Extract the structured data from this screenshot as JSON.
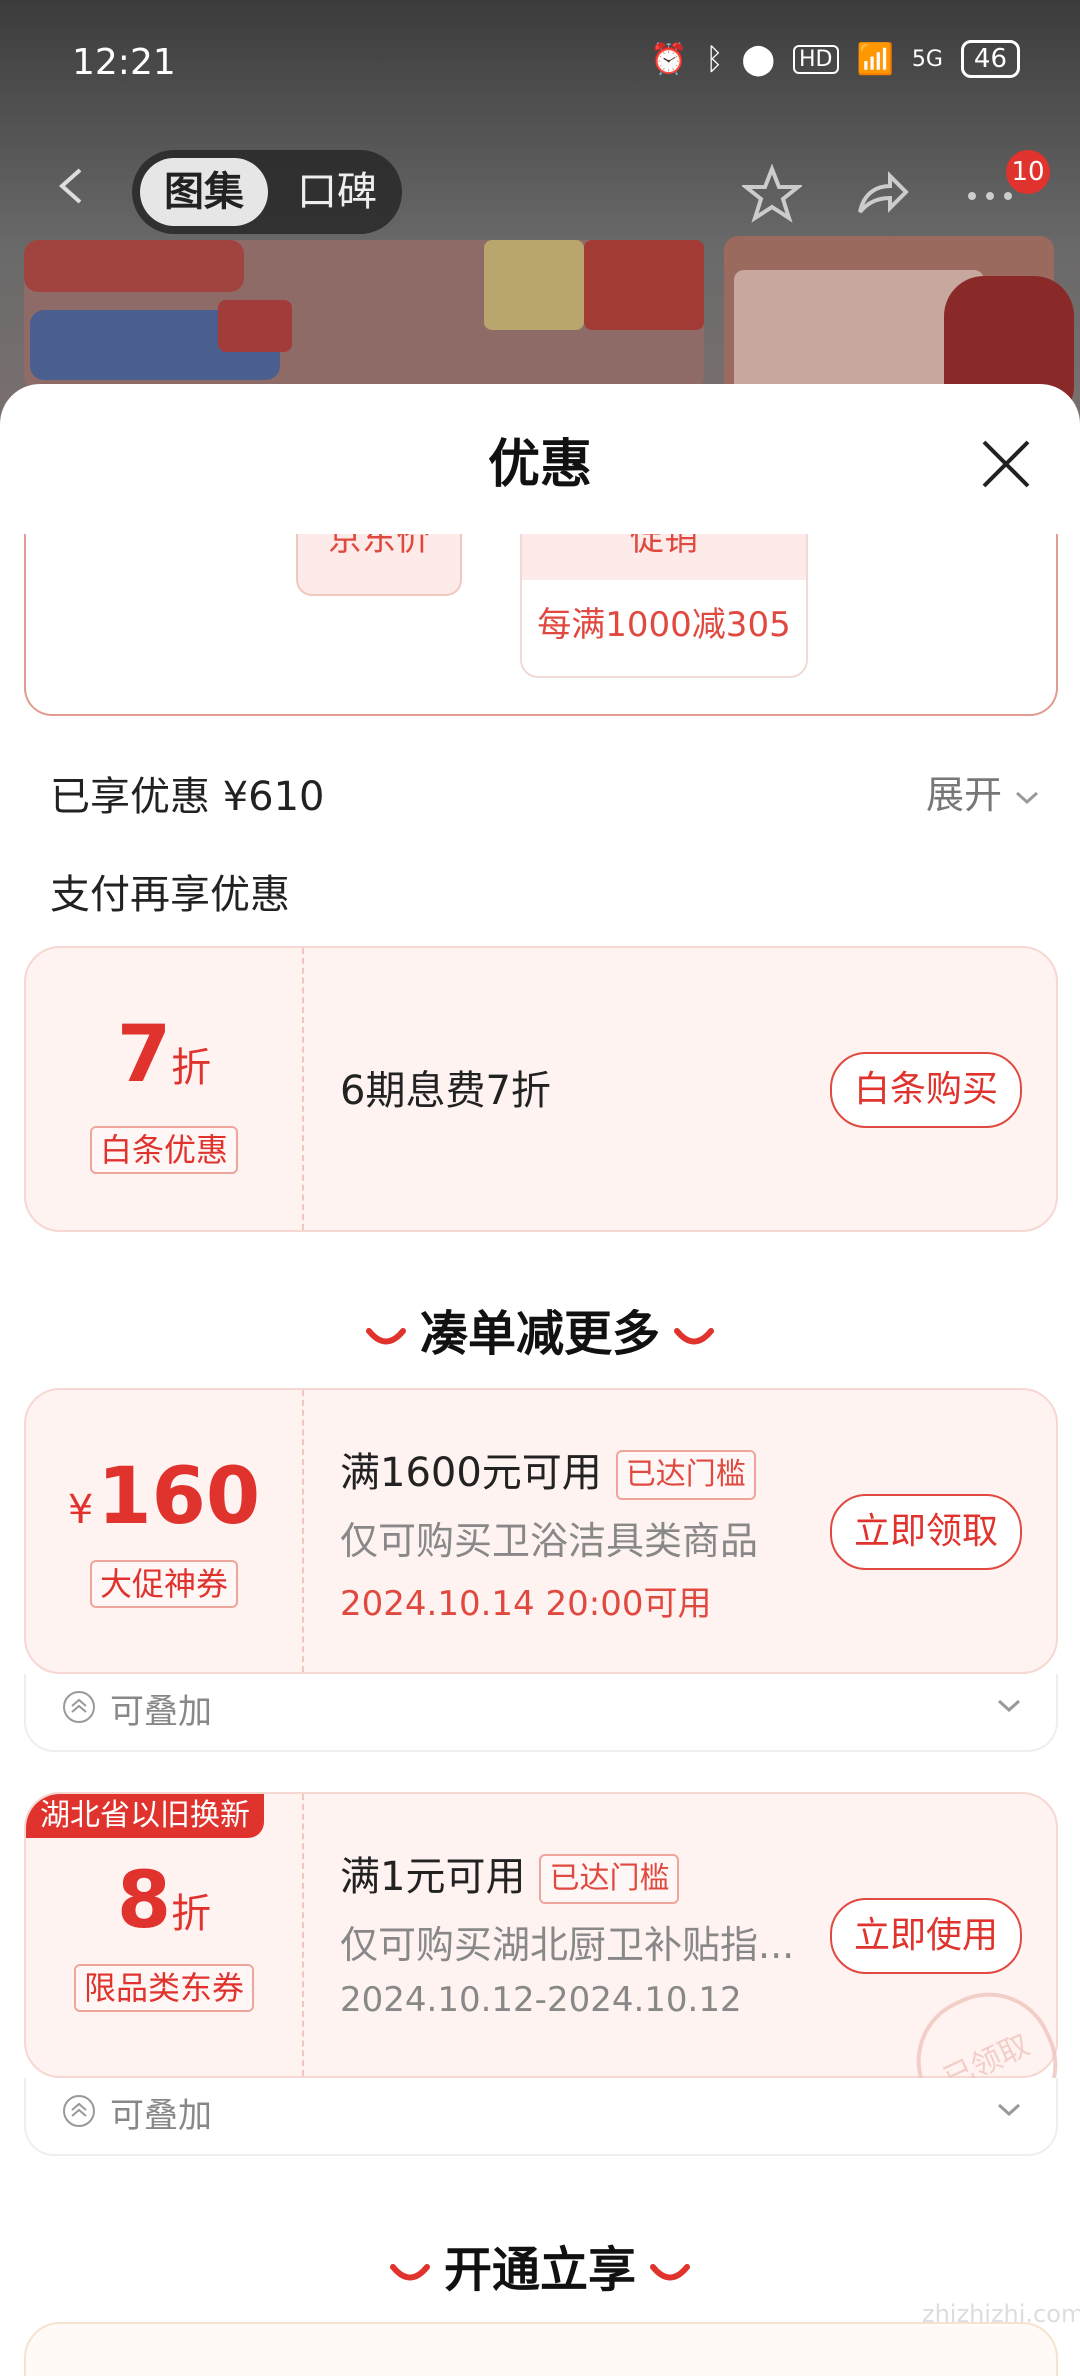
{
  "status_bar": {
    "time": "12:21",
    "battery": "46",
    "network": "5G",
    "hd": "HD"
  },
  "nav": {
    "tabs": [
      "图集",
      "口碑"
    ],
    "badge_count": "10"
  },
  "sheet": {
    "title": "优惠",
    "promo": {
      "jd_price_label": "京东价",
      "promo_head": "促销",
      "promo_value": "每满1000减305"
    },
    "enjoyed": "已享优惠 ¥610",
    "expand": "展开",
    "pay_more": "支付再享优惠"
  },
  "baitiao": {
    "big_num": "7",
    "unit": "折",
    "tag": "白条优惠",
    "title": "6期息费7折",
    "button": "白条购买"
  },
  "section_more": "凑单减更多",
  "coupon1": {
    "currency": "¥",
    "amount": "160",
    "tag": "大促神券",
    "title": "满1600元可用",
    "reached": "已达门槛",
    "desc": "仅可购买卫浴洁具类商品",
    "time": "2024.10.14 20:00可用",
    "button": "立即领取",
    "stack": "可叠加"
  },
  "coupon2": {
    "corner": "湖北省以旧换新",
    "big_num": "8",
    "unit": "折",
    "tag": "限品类东券",
    "title": "满1元可用",
    "reached": "已达门槛",
    "desc": "仅可购买湖北厨卫补贴指...",
    "time": "2024.10.12-2024.10.12",
    "button": "立即使用",
    "stamp": "已领取",
    "stack": "可叠加"
  },
  "section_open": "开通立享",
  "watermark": "zhizhizhi.com",
  "colors": {
    "accent": "#e0332d",
    "card_bg": "#fff3f1"
  }
}
